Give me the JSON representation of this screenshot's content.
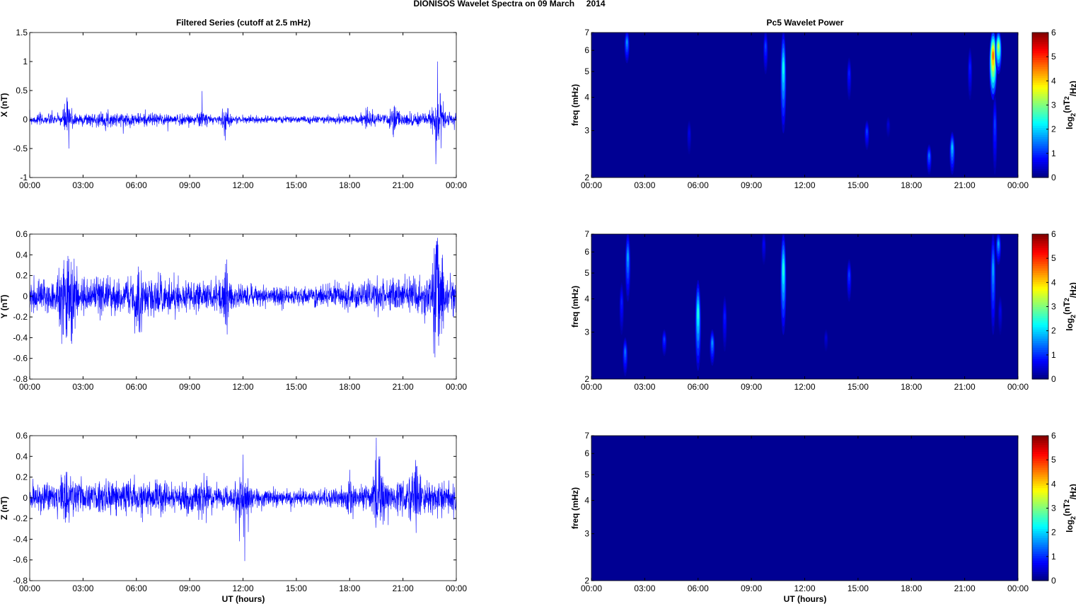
{
  "chart_data": {
    "title": "DIONISOS Wavelet Spectra on 09 March     2014",
    "left_title": "Filtered Series (cutoff at 2.5 mHz)",
    "right_title": "Pc5 Wavelet Power",
    "xlabel": "UT (hours)",
    "x_ticks": [
      "00:00",
      "03:00",
      "06:00",
      "09:00",
      "12:00",
      "15:00",
      "18:00",
      "21:00",
      "00:00"
    ],
    "xlim": [
      0,
      24
    ],
    "series": [
      {
        "type": "line",
        "name": "X",
        "ylabel": "X (nT)",
        "ylim": [
          -1,
          1.5
        ],
        "y_ticks": [
          "-1",
          "-0.5",
          "0",
          "0.5",
          "1",
          "1.5"
        ],
        "color": "#0000ff",
        "noise": 0.05,
        "events": [
          [
            2.1,
            0.38
          ],
          [
            2.2,
            -0.5
          ],
          [
            9.7,
            0.49
          ],
          [
            11.0,
            0.36
          ],
          [
            11.0,
            -0.36
          ],
          [
            22.95,
            1.0
          ],
          [
            22.85,
            -0.77
          ],
          [
            23.1,
            0.45
          ],
          [
            19.0,
            0.22
          ],
          [
            20.5,
            0.22
          ]
        ]
      },
      {
        "type": "line",
        "name": "Y",
        "ylabel": "Y (nT)",
        "ylim": [
          -0.8,
          0.6
        ],
        "y_ticks": [
          "-0.8",
          "-0.6",
          "-0.4",
          "-0.2",
          "0",
          "0.2",
          "0.4",
          "0.6"
        ],
        "color": "#0000ff",
        "noise": 0.08,
        "events": [
          [
            2.2,
            0.36
          ],
          [
            1.8,
            -0.46
          ],
          [
            2.4,
            -0.36
          ],
          [
            6.2,
            -0.35
          ],
          [
            11.0,
            0.37
          ],
          [
            11.0,
            -0.27
          ],
          [
            22.9,
            0.53
          ],
          [
            22.8,
            -0.59
          ],
          [
            23.2,
            0.37
          ]
        ]
      },
      {
        "type": "line",
        "name": "Z",
        "ylabel": "Z (nT)",
        "ylim": [
          -0.8,
          0.6
        ],
        "y_ticks": [
          "-0.8",
          "-0.6",
          "-0.4",
          "-0.2",
          "0",
          "0.2",
          "0.4",
          "0.6"
        ],
        "color": "#0000ff",
        "noise": 0.07,
        "events": [
          [
            2.1,
            0.25
          ],
          [
            12.1,
            -0.61
          ],
          [
            11.8,
            -0.42
          ],
          [
            12.3,
            -0.33
          ],
          [
            9.8,
            0.24
          ],
          [
            19.5,
            0.58
          ],
          [
            18.0,
            0.27
          ],
          [
            19.7,
            0.4
          ],
          [
            21.7,
            0.26
          ]
        ]
      }
    ],
    "spectra": [
      {
        "type": "heatmap",
        "ylabel": "freq (mHz)",
        "ylim": [
          2,
          7
        ],
        "y_ticks": [
          "2",
          "3",
          "4",
          "5",
          "6",
          "7"
        ],
        "blobs": [
          [
            2.0,
            5.5,
            7,
            1.5
          ],
          [
            9.8,
            5,
            7,
            1
          ],
          [
            10.8,
            3,
            7,
            2.2
          ],
          [
            14.5,
            4,
            5.5,
            0.8
          ],
          [
            15.5,
            2.6,
            3.2,
            1
          ],
          [
            19.0,
            2.1,
            2.6,
            1.3
          ],
          [
            20.3,
            2.1,
            2.9,
            1.8
          ],
          [
            21.3,
            4,
            6,
            0.8
          ],
          [
            22.6,
            4,
            7,
            4.5
          ],
          [
            22.9,
            5,
            7,
            3.2
          ],
          [
            22.7,
            2.1,
            4,
            1
          ],
          [
            5.5,
            2.5,
            3.2,
            0.5
          ],
          [
            16.7,
            2.9,
            3.3,
            0.4
          ]
        ]
      },
      {
        "type": "heatmap",
        "ylabel": "freq (mHz)",
        "ylim": [
          2,
          7
        ],
        "y_ticks": [
          "2",
          "3",
          "4",
          "5",
          "6",
          "7"
        ],
        "blobs": [
          [
            1.9,
            2.1,
            2.8,
            1.3
          ],
          [
            1.7,
            3,
            4.5,
            0.8
          ],
          [
            2.05,
            4,
            7,
            1.6
          ],
          [
            4.1,
            2.5,
            3,
            1
          ],
          [
            6.0,
            2.2,
            4.6,
            2.3
          ],
          [
            6.8,
            2.3,
            3.0,
            1.5
          ],
          [
            7.5,
            2.6,
            4,
            0.8
          ],
          [
            9.7,
            5.5,
            7,
            0.6
          ],
          [
            10.8,
            3,
            7,
            2.3
          ],
          [
            14.5,
            4,
            5.5,
            1
          ],
          [
            13.2,
            2.6,
            3,
            0.4
          ],
          [
            22.6,
            3,
            7,
            1.6
          ],
          [
            22.9,
            5.5,
            7,
            1.6
          ],
          [
            23.0,
            3,
            4,
            0.5
          ]
        ]
      },
      {
        "type": "heatmap",
        "ylabel": "freq (mHz)",
        "ylim": [
          2,
          7
        ],
        "y_ticks": [
          "2",
          "3",
          "4",
          "5",
          "6",
          "7"
        ],
        "blobs": []
      }
    ],
    "colorbar": {
      "label": "log2(nT2/Hz)",
      "ticks": [
        "0",
        "1",
        "2",
        "3",
        "4",
        "5",
        "6"
      ],
      "range": [
        0,
        6
      ]
    }
  }
}
